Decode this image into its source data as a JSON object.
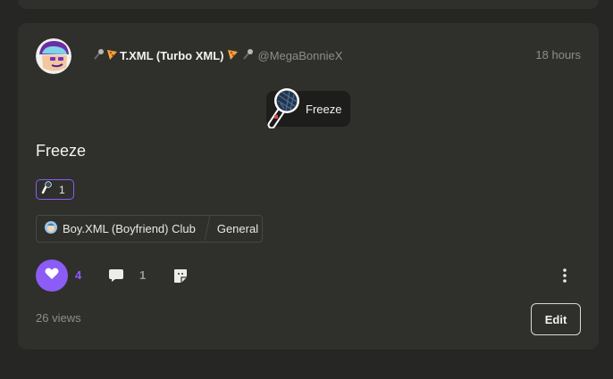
{
  "post": {
    "author": {
      "name": "T.XML (Turbo XML)",
      "handle": "@MegaBonnieX",
      "icons": [
        "microphone-icon",
        "pizza-icon",
        "pizza-icon",
        "microphone-icon"
      ]
    },
    "time": "18 hours",
    "sticker": {
      "label": "Freeze",
      "icon": "microphone-icon"
    },
    "title": "Freeze",
    "reaction": {
      "icon": "microphone-icon",
      "count": "1"
    },
    "tag": {
      "club": "Boy.XML (Boyfriend) Club",
      "category": "General"
    },
    "likes": "4",
    "comments": "1",
    "views": "26 views",
    "edit_label": "Edit"
  },
  "colors": {
    "accent": "#8b5cf6",
    "card": "#2f302c",
    "background": "#262724"
  }
}
